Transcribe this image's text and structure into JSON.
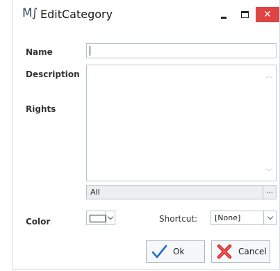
{
  "window": {
    "logo": "M∫",
    "title": "EditCategory",
    "close_glyph": "✕"
  },
  "form": {
    "name_label": "Name",
    "name_value": "",
    "description_label": "Description",
    "description_value": "",
    "rights_label": "Rights",
    "rights_value": "All",
    "rights_more": "...",
    "color_label": "Color",
    "color_value": "#ffffff",
    "shortcut_label": "Shortcut:",
    "shortcut_value": "[None]"
  },
  "buttons": {
    "ok_label": "Ok",
    "cancel_label": "Cancel"
  },
  "colors": {
    "close_bg": "#e04343",
    "ok_check": "#1f6fd0",
    "cancel_x": "#d92020"
  }
}
